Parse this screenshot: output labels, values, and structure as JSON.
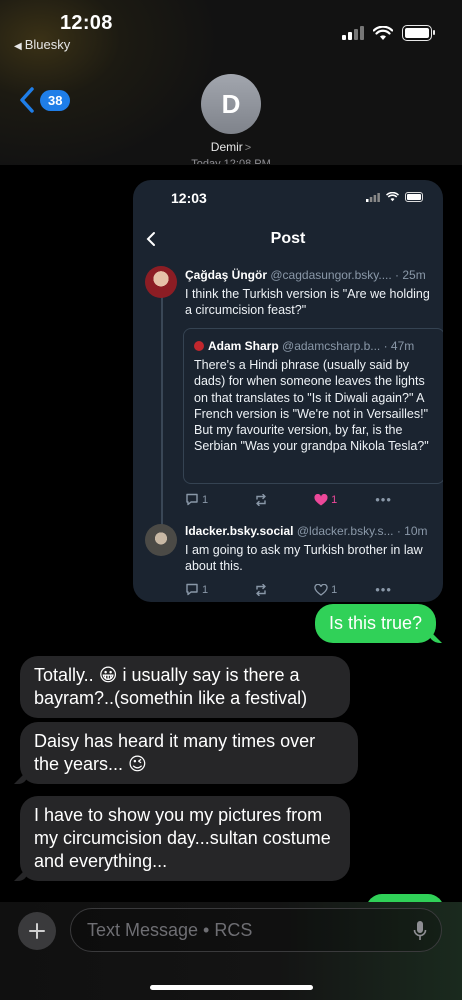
{
  "status_bar": {
    "time": "12:08",
    "back_app": "Bluesky"
  },
  "header": {
    "back_count": "38",
    "contact_initial": "D",
    "contact_name": "Demir",
    "timestamp_peek": "Today 12:08 PM"
  },
  "screenshot": {
    "time": "12:03",
    "title": "Post",
    "post1": {
      "name": "Çağdaş Üngör",
      "handle": "@cagdasungor.bsky....",
      "age": " · 25m",
      "text": "I think the Turkish version is \"Are we holding a circumcision feast?\""
    },
    "quote": {
      "name": "Adam Sharp",
      "handle": "@adamcsharp.b...",
      "age": " · 47m",
      "text": "There's a Hindi phrase (usually said by dads) for when someone leaves the lights on that translates to \"Is it Diwali again?\" A French version is \"We're not in Versailles!\" But my favourite version, by far, is the Serbian \"Was your grandpa Nikola Tesla?\""
    },
    "post1_actions": {
      "replies": "1",
      "likes": "1"
    },
    "post2": {
      "name": "ldacker.bsky.social",
      "handle": "@ldacker.bsky.s...",
      "age": " · 10m",
      "text": "I am going to ask my Turkish brother in law about this."
    },
    "post2_actions": {
      "replies": "1",
      "likes": "1"
    }
  },
  "messages": {
    "out1": "Is this true?",
    "in1": "Totally.. 😀 i usually say is there a bayram?..(somethin like a festival)",
    "in2": "Daisy has heard it many times over the years... 😉",
    "in3": "I have to show you my pictures from my circumcision day...sultan costume and everything..."
  },
  "composer": {
    "placeholder": "Text Message • RCS"
  },
  "colors": {
    "outgoing": "#30d158",
    "incoming": "#262628",
    "badge": "#1f7ee8",
    "like": "#ec4899"
  }
}
